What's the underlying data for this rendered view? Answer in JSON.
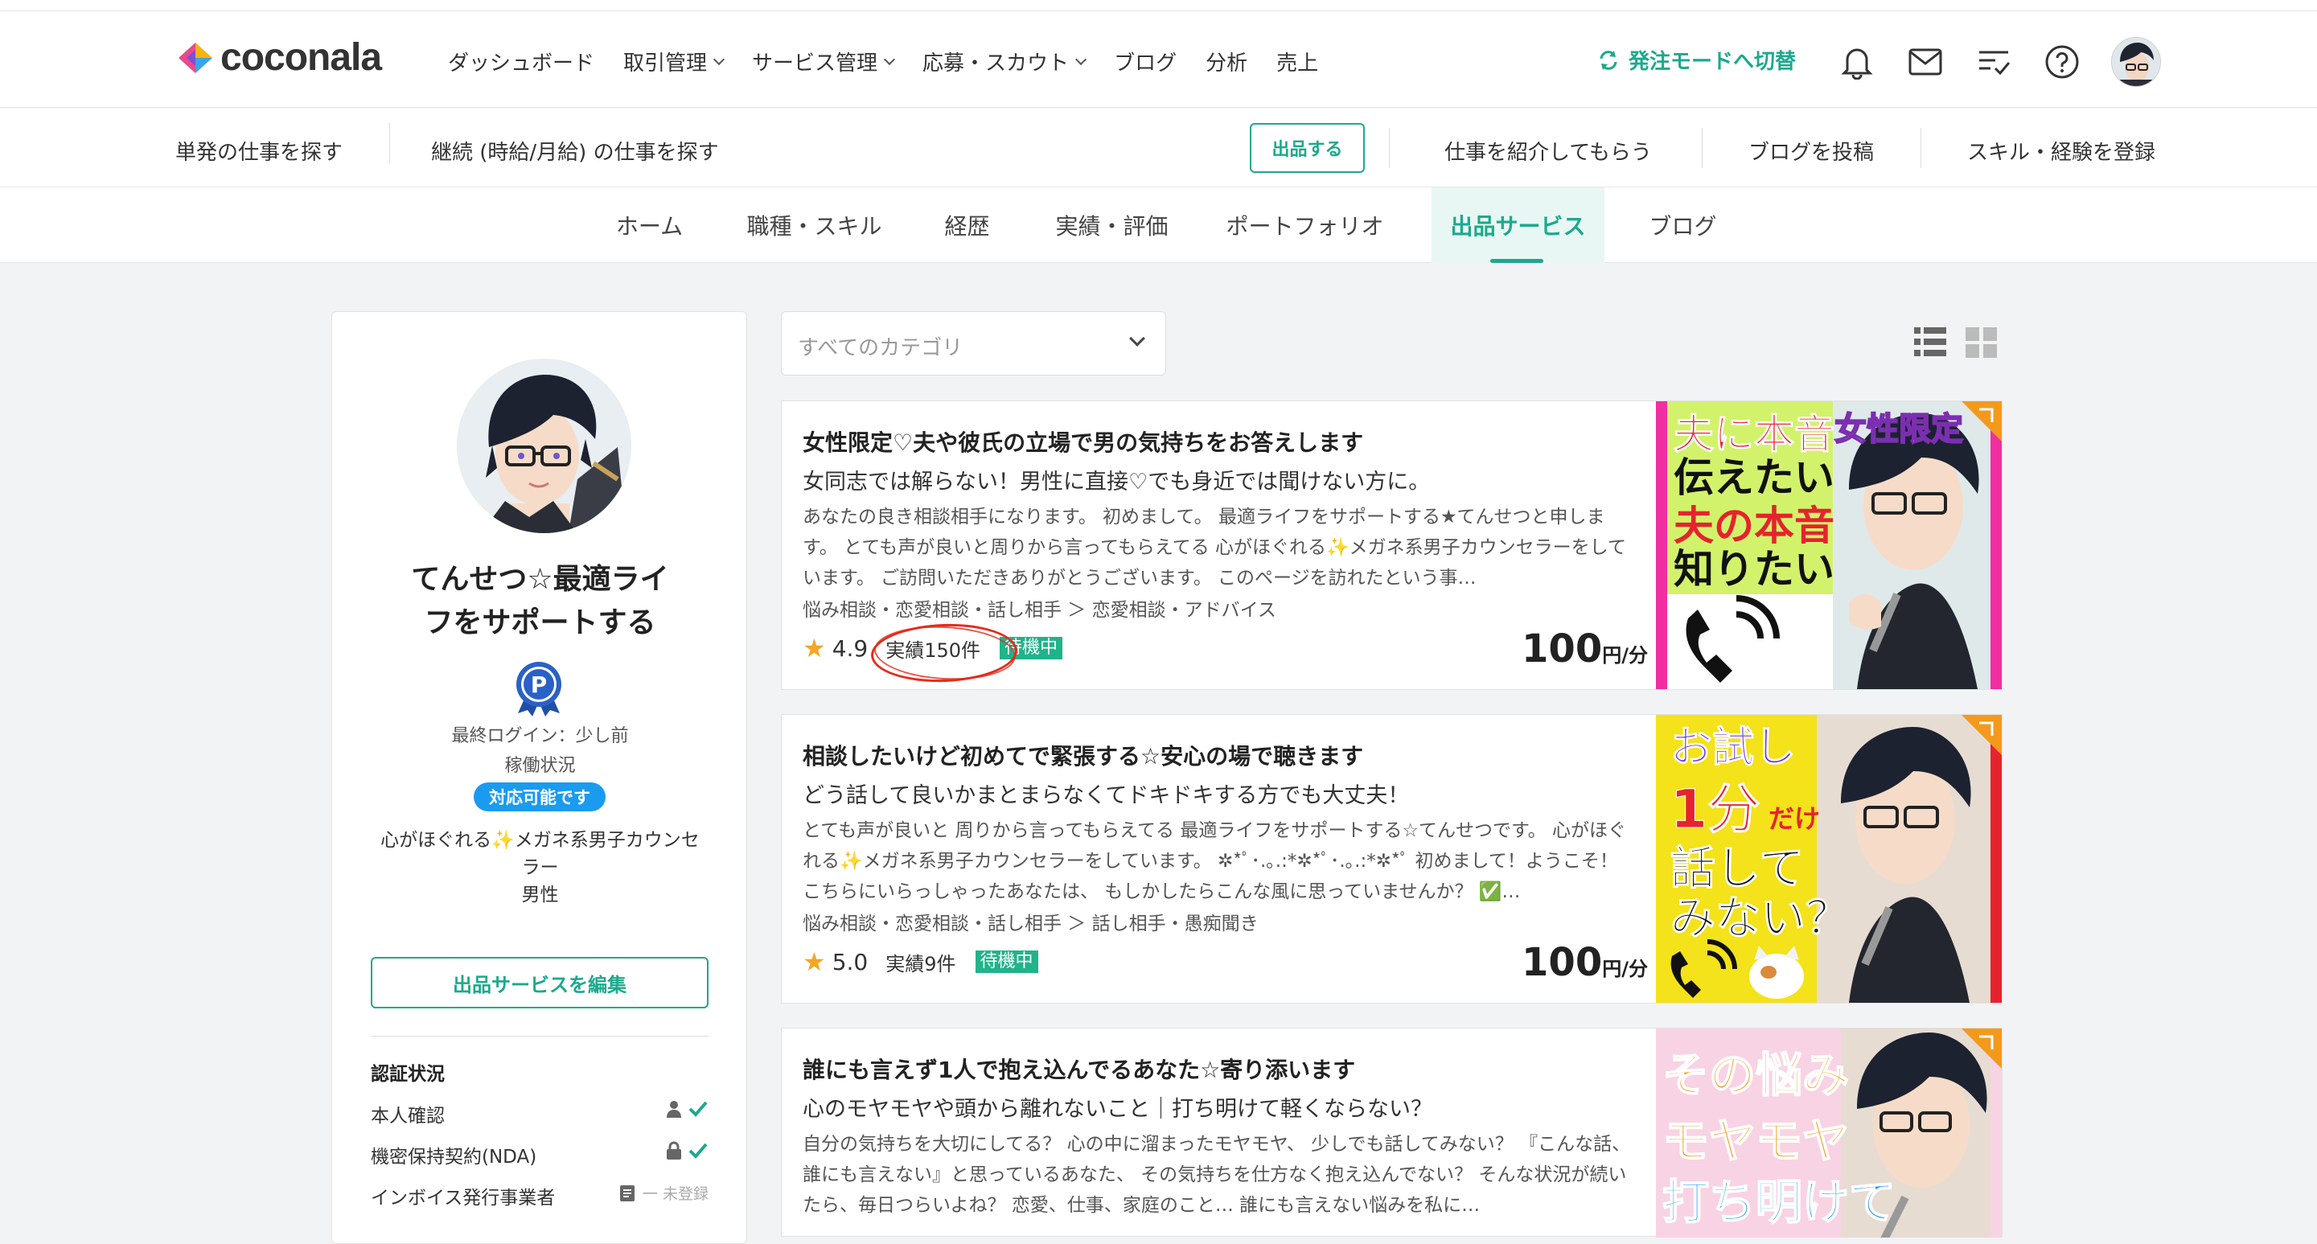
{
  "header": {
    "logo_text": "coconala",
    "nav": [
      {
        "label": "ダッシュボード",
        "dropdown": false
      },
      {
        "label": "取引管理",
        "dropdown": true
      },
      {
        "label": "サービス管理",
        "dropdown": true
      },
      {
        "label": "応募・スカウト",
        "dropdown": true
      },
      {
        "label": "ブログ",
        "dropdown": false
      },
      {
        "label": "分析",
        "dropdown": false
      },
      {
        "label": "売上",
        "dropdown": false
      }
    ],
    "switch_mode": "発注モードへ切替",
    "icons": [
      "bell-icon",
      "mail-icon",
      "checklist-icon",
      "help-icon"
    ]
  },
  "subbar": {
    "find_single": "単発の仕事を探す",
    "find_continuous": "継続 (時給/月給) の仕事を探す",
    "list_button": "出品する",
    "introduce": "仕事を紹介してもらう",
    "post_blog": "ブログを投稿",
    "register_skill": "スキル・経験を登録"
  },
  "tabs": [
    "ホーム",
    "職種・スキル",
    "経歴",
    "実績・評価",
    "ポートフォリオ",
    "出品サービス",
    "ブログ"
  ],
  "active_tab": "出品サービス",
  "profile": {
    "name_line1": "てんせつ☆最適ライ",
    "name_line2": "フをサポートする",
    "last_login": "最終ログイン：少し前",
    "status_label": "稼働状況",
    "status": "対応可能です",
    "desc_line1": "心がほぐれる✨メガネ系男子カウンセ",
    "desc_line2": "ラー",
    "gender": "男性",
    "edit_button": "出品サービスを編集",
    "auth_title": "認証状況",
    "auth": [
      {
        "label": "本人確認",
        "state": ""
      },
      {
        "label": "機密保持契約(NDA)",
        "state": ""
      },
      {
        "label": "インボイス発行事業者",
        "state": "一 未登録"
      }
    ]
  },
  "filter": {
    "category": "すべてのカテゴリ"
  },
  "services": [
    {
      "title": "女性限定♡夫や彼氏の立場で男の気持ちをお答えします",
      "subtitle": "女同志では解らない！男性に直接♡でも身近では聞けない方に。",
      "desc": "あなたの良き相談相手になります。 初めまして。 最適ライフをサポートする★てんせつと申します。 とても声が良いと周りから言ってもらえてる 心がほぐれる✨メガネ系男子カウンセラーをしています。 ご訪問いただきありがとうございます。 このページを訪れたという事…",
      "category": "悩み相談・恋愛相談・話し相手 ＞ 恋愛相談・アドバイス",
      "rating": "4.9",
      "count": "実績150件",
      "badge": "待機中",
      "price": "100",
      "unit": "円/分",
      "thumb": {
        "l1": "夫に本音",
        "l2": "伝えたい",
        "l3": "夫の本音",
        "l4": "知りたい",
        "tag": "女性限定"
      }
    },
    {
      "title": "相談したいけど初めてで緊張する☆安心の場で聴きます",
      "subtitle": "どう話して良いかまとまらなくてドキドキする方でも大丈夫！",
      "desc": "とても声が良いと 周りから言ってもらえてる 最適ライフをサポートする☆てんせつです。 心がほぐれる✨メガネ系男子カウンセラーをしています。 ✲*ﾟ･.｡.:*✲*ﾟ･.｡.:*✲*ﾟ 初めまして！ようこそ！ こちらにいらっしゃったあなたは、 もしかしたらこんな風に思っていませんか？ ✅…",
      "category": "悩み相談・恋愛相談・話し相手 ＞ 話し相手・愚痴聞き",
      "rating": "5.0",
      "count": "実績9件",
      "badge": "待機中",
      "price": "100",
      "unit": "円/分",
      "thumb": {
        "l1": "お試し",
        "l2": "1分",
        "l2b": "だけ",
        "l3": "話して",
        "l4": "みない？"
      }
    },
    {
      "title": "誰にも言えず1人で抱え込んでるあなた☆寄り添います",
      "subtitle": "心のモヤモヤや頭から離れないこと｜打ち明けて軽くならない？",
      "desc": "自分の気持ちを大切にしてる？ 心の中に溜まったモヤモヤ、 少しでも話してみない？ 『こんな話、誰にも言えない』と思っているあなた、 その気持ちを仕方なく抱え込んでない？ そんな状況が続いたら、毎日つらいよね？ 恋愛、仕事、家庭のこと… 誰にも言えない悩みを私に…",
      "thumb": {
        "l1": "その悩み",
        "l2": "モヤモヤ",
        "l3": "打ち明けて"
      }
    }
  ],
  "colors": {
    "accent": "#1ca98c",
    "blue_badge": "#1a9bef",
    "star": "#f5a623",
    "annotation": "#e52a1c"
  }
}
